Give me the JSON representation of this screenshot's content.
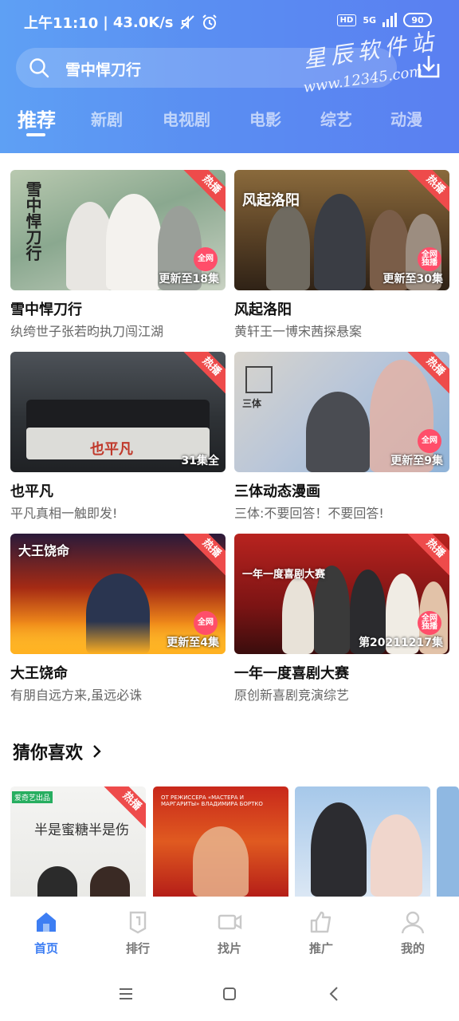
{
  "status_bar": {
    "time": "上午11:10",
    "net_speed": "43.0K/s",
    "hd": "HD",
    "signal": "5G",
    "battery": "90"
  },
  "search": {
    "query": "雪中悍刀行",
    "watermark_line1": "星辰软件站",
    "watermark_line2": "www.12345.com"
  },
  "tabs": [
    "推荐",
    "新剧",
    "电视剧",
    "电影",
    "综艺",
    "动漫"
  ],
  "cards": [
    {
      "title": "雪中悍刀行",
      "subtitle": "纨绔世子张若昀执刀闯江湖",
      "badge": "热播",
      "episode": "更新至18集",
      "network": "全网",
      "poster_text": "雪中悍刀行"
    },
    {
      "title": "风起洛阳",
      "subtitle": "黄轩王一博宋茜探悬案",
      "badge": "热播",
      "episode": "更新至30集",
      "network": "全网\n独播",
      "poster_text": "风起洛阳"
    },
    {
      "title": "也平凡",
      "subtitle": "平凡真相一触即发!",
      "badge": "热播",
      "episode": "31集全",
      "network": "",
      "poster_text": "也平凡"
    },
    {
      "title": "三体动态漫画",
      "subtitle": "三体:不要回答！不要回答!",
      "badge": "热播",
      "episode": "更新至9集",
      "network": "全网",
      "poster_text": "三体"
    },
    {
      "title": "大王饶命",
      "subtitle": "有朋自远方来,虽远必诛",
      "badge": "热播",
      "episode": "更新至4集",
      "network": "全网",
      "poster_text": "大王饶命"
    },
    {
      "title": "一年一度喜剧大赛",
      "subtitle": "原创新喜剧竞演综艺",
      "badge": "热播",
      "episode": "第20211217集",
      "network": "全网\n独播",
      "poster_text": "一年一度喜剧大赛"
    }
  ],
  "guess": {
    "heading": "猜你喜欢",
    "badge": "热播",
    "strip1_text": "半是蜜糖半是伤",
    "strip1_tag": "爱奇艺出品",
    "strip2_text": "ОТ РЕЖИССЕРА «МАСТЕРА И МАРГАРИТЫ» ВЛАДИМИРА БОРТКО"
  },
  "bottom_nav": [
    {
      "label": "首页",
      "icon": "home-icon",
      "active": true
    },
    {
      "label": "排行",
      "icon": "ranking-icon",
      "active": false
    },
    {
      "label": "找片",
      "icon": "video-camera-icon",
      "active": false
    },
    {
      "label": "推广",
      "icon": "thumbs-up-icon",
      "active": false
    },
    {
      "label": "我的",
      "icon": "profile-icon",
      "active": false
    }
  ],
  "colors": {
    "accent": "#3d7ef3",
    "hot_badge": "#ee4b4b",
    "header_start": "#5ea0f4",
    "header_end": "#5a7ff1"
  }
}
